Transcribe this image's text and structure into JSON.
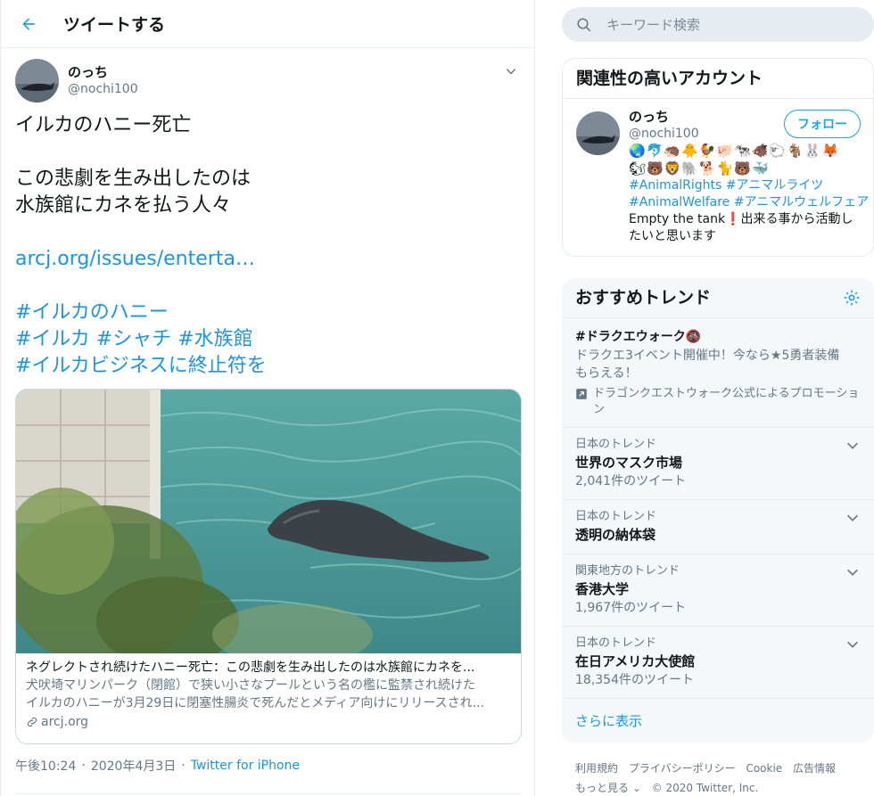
{
  "header": {
    "title": "ツイートする"
  },
  "tweet": {
    "user_name": "のっち",
    "user_handle": "@nochi100",
    "body_lines": [
      "イルカのハニー死亡",
      "",
      "この悲劇を生み出したのは",
      "水族館にカネを払う人々",
      "",
      "arcj.org/issues/enterta…",
      "",
      "#イルカのハニー",
      "#イルカ #シャチ #水族館",
      "#イルカビジネスに終止符を"
    ],
    "card": {
      "title": "ネグレクトされ続けたハニー死亡：この悲劇を生み出したのは水族館にカネを...",
      "desc_line1": "犬吠埼マリンパーク（閉館）で狭い小さなプールという名の檻に監禁され続けた",
      "desc_line2": "イルカのハニーが3月29日に閉塞性腸炎で死んだとメディア向けにリリースされ...",
      "domain": "arcj.org"
    },
    "time": "午後10:24",
    "date": "2020年4月3日",
    "source": "Twitter for iPhone"
  },
  "search": {
    "placeholder": "キーワード検索"
  },
  "related": {
    "title": "関連性の高いアカウント",
    "name": "のっち",
    "handle": "@nochi100",
    "follow_label": "フォロー",
    "emoji_line1": "🌏🐬🦔🐥🐓🐖🐄🐗🐑🐐🐰🦊",
    "emoji_line2": "🐿🐻🦁🐘🐕🐈🐻🐳",
    "tags_line1a": "#AnimalRights",
    "tags_line1b": "#アニマルライツ",
    "tags_line2a": "#AnimalWelfare",
    "tags_line2b": "#アニマルウェルフェア",
    "bio_line1": "Empty the tank❗出来る事から活動し",
    "bio_line2": "たいと思います"
  },
  "trends": {
    "title": "おすすめトレンド",
    "promoted": {
      "name": "#ドラクエウォーク🚳",
      "desc_line1": "ドラクエ3イベント開催中！今なら★5勇者装備",
      "desc_line2": "もらえる！",
      "promo_line1": "ドラゴンクエストウォーク公式によるプロモーショ",
      "promo_line2": "ン"
    },
    "items": [
      {
        "context": "日本のトレンド",
        "name": "世界のマスク市場",
        "count": "2,041件のツイート"
      },
      {
        "context": "日本のトレンド",
        "name": "透明の納体袋",
        "count": ""
      },
      {
        "context": "関東地方のトレンド",
        "name": "香港大学",
        "count": "1,967件のツイート"
      },
      {
        "context": "日本のトレンド",
        "name": "在日アメリカ大使館",
        "count": "18,354件のツイート"
      }
    ],
    "show_more": "さらに表示"
  },
  "footer": {
    "links": [
      "利用規約",
      "プライバシーポリシー",
      "Cookie",
      "広告情報"
    ],
    "more": "もっと見る ⌄",
    "copyright": "© 2020 Twitter, Inc."
  }
}
